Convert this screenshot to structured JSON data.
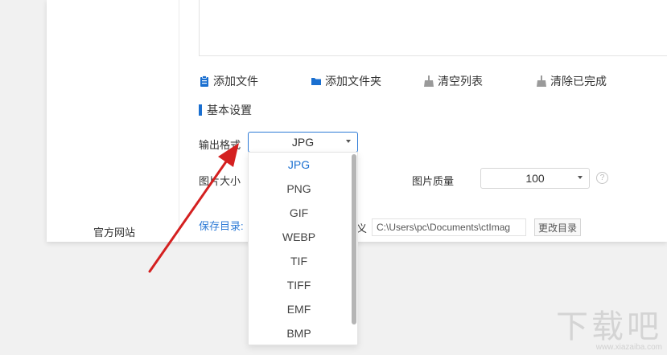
{
  "sidebar": {
    "official_site": "官方网站"
  },
  "toolbar": {
    "add_file": "添加文件",
    "add_folder": "添加文件夹",
    "clear_list": "清空列表",
    "clear_done": "清除已完成"
  },
  "settings": {
    "title": "基本设置",
    "output_format_label": "输出格式",
    "output_format_value": "JPG",
    "image_size_label": "图片大小",
    "image_quality_label": "图片质量",
    "image_quality_value": "100",
    "help": "?",
    "save_dir_label": "保存目录:",
    "custom_suffix": "义",
    "save_path": "C:\\Users\\pc\\Documents\\ctImag",
    "change_dir": "更改目录"
  },
  "format_dropdown": {
    "options": [
      "JPG",
      "PNG",
      "GIF",
      "WEBP",
      "TIF",
      "TIFF",
      "EMF",
      "BMP"
    ],
    "selected": "JPG"
  },
  "watermark": {
    "text": "下载吧",
    "url": "www.xiazaiba.com"
  },
  "colors": {
    "accent": "#1a6fd0",
    "arrow": "#d42020",
    "link": "#2d7ad6"
  }
}
